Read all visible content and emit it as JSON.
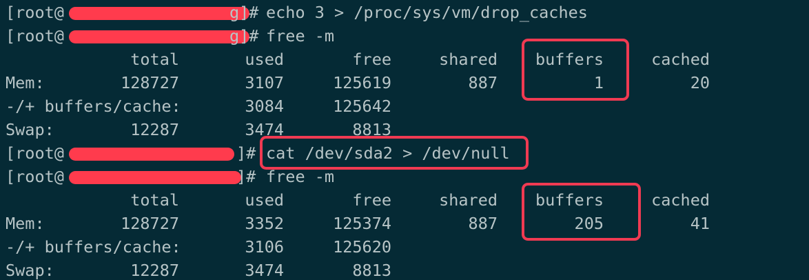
{
  "accent_color": "#f03a52",
  "background_color": "#052a35",
  "prompt": {
    "prefix": "[root@",
    "suffix": "g]#",
    "suffix_alt": "]#"
  },
  "commands": {
    "c1": "echo 3 > /proc/sys/vm/drop_caches",
    "c2": "free -m",
    "c3": "cat /dev/sda2 > /dev/null",
    "c4": "free -m"
  },
  "headers": {
    "total": "total",
    "used": "used",
    "free": "free",
    "shared": "shared",
    "buffers": "buffers",
    "cached": "cached"
  },
  "labels": {
    "mem": "Mem:",
    "bufcache": "-/+ buffers/cache:",
    "swap": "Swap:"
  },
  "free1": {
    "mem": {
      "total": "128727",
      "used": "3107",
      "free": "125619",
      "shared": "887",
      "buffers": "1",
      "cached": "20"
    },
    "bufcache": {
      "used": "3084",
      "free": "125642"
    },
    "swap": {
      "total": "12287",
      "used": "3474",
      "free": "8813"
    }
  },
  "free2": {
    "mem": {
      "total": "128727",
      "used": "3352",
      "free": "125374",
      "shared": "887",
      "buffers": "205",
      "cached": "41"
    },
    "bufcache": {
      "used": "3106",
      "free": "125620"
    },
    "swap": {
      "total": "12287",
      "used": "3474",
      "free": "8813"
    }
  }
}
